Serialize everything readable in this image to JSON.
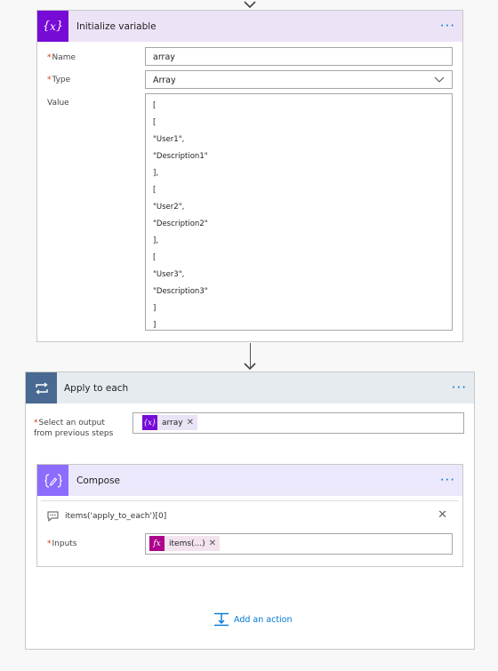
{
  "init_variable": {
    "title": "Initialize variable",
    "name_label": "Name",
    "name_value": "array",
    "type_label": "Type",
    "type_value": "Array",
    "value_label": "Value",
    "value_lines": [
      "[",
      "[",
      "\"User1\",",
      "\"Description1\"",
      "],",
      "[",
      "\"User2\",",
      "\"Description2\"",
      "],",
      "[",
      "\"User3\",",
      "\"Description3\"",
      "]",
      "]"
    ],
    "more": "···"
  },
  "apply_each": {
    "title": "Apply to each",
    "select_label_line1": "Select an output",
    "select_label_line2": "from previous steps",
    "token_label": "array",
    "more": "···"
  },
  "compose": {
    "title": "Compose",
    "comment": "items('apply_to_each')[0]",
    "inputs_label": "Inputs",
    "token_label": "items(...)",
    "more": "···"
  },
  "add_action_label": "Add an action",
  "colors": {
    "variable_purple": "#770bd6",
    "variable_header": "#ede3f7",
    "loop_gray": "#486991",
    "loop_header": "#e6ebf0",
    "compose_purple": "#8c6cff",
    "compose_header": "#ece8fc",
    "expression_magenta": "#ad008c",
    "link_blue": "#0078d4"
  }
}
